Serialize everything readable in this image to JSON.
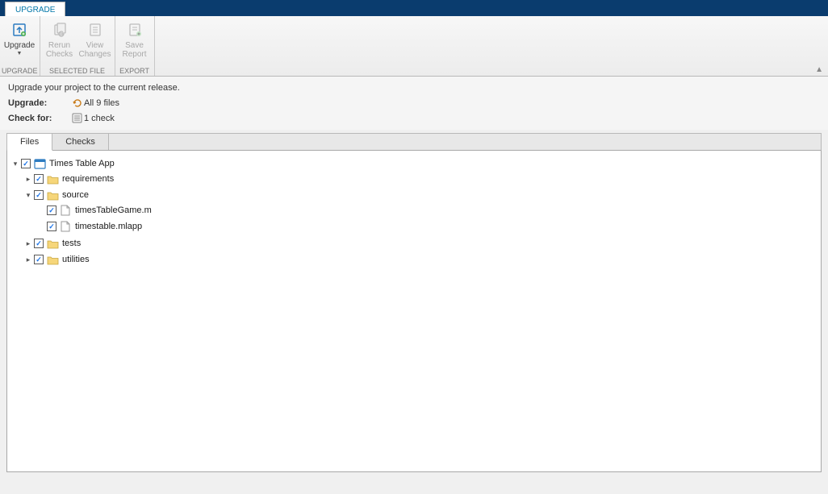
{
  "ribbon": {
    "tab": "UPGRADE",
    "groups": {
      "upgrade": {
        "label": "UPGRADE",
        "btn_upgrade": "Upgrade"
      },
      "selected": {
        "label": "SELECTED FILE",
        "btn_rerun1": "Rerun",
        "btn_rerun2": "Checks",
        "btn_view1": "View",
        "btn_view2": "Changes"
      },
      "export": {
        "label": "EXPORT",
        "btn_save1": "Save",
        "btn_save2": "Report"
      }
    }
  },
  "info": {
    "status": "Upgrade your project to the current release.",
    "upgrade_label": "Upgrade:",
    "upgrade_value": "All 9 files",
    "check_label": "Check for:",
    "check_value": "1 check"
  },
  "tabs": {
    "files": "Files",
    "checks": "Checks"
  },
  "tree": {
    "root": "Times Table App",
    "requirements": "requirements",
    "source": "source",
    "file1": "timesTableGame.m",
    "file2": "timestable.mlapp",
    "tests": "tests",
    "utilities": "utilities"
  }
}
